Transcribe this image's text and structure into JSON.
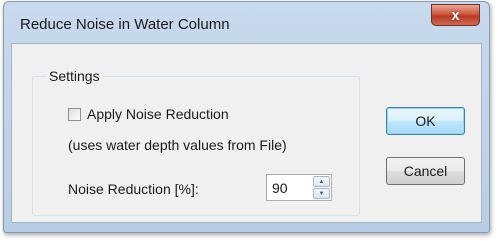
{
  "window": {
    "title": "Reduce Noise in Water Column",
    "close_icon": "close-icon",
    "close_glyph": "x"
  },
  "settings": {
    "group_label": "Settings",
    "apply_noise_reduction": {
      "label": "Apply Noise Reduction",
      "checked": false
    },
    "note": "(uses water depth values from File)",
    "noise_reduction": {
      "label": "Noise Reduction [%]:",
      "value": "90"
    }
  },
  "buttons": {
    "ok": "OK",
    "cancel": "Cancel"
  },
  "colors": {
    "titlebar": "#b9cde6",
    "close_button": "#c7432a",
    "client_background": "#f0f0f0",
    "default_button_border": "#3c7fb1"
  }
}
